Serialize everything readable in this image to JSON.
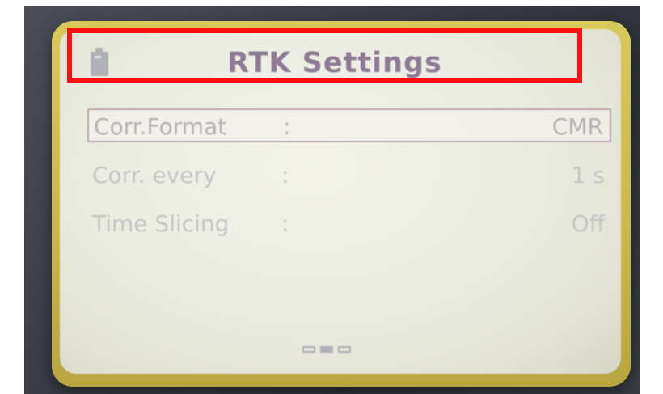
{
  "screen": {
    "title": "RTK Settings",
    "title_icon": "sd-card-icon"
  },
  "settings": [
    {
      "label": "Corr.Format",
      "separator": ":",
      "value": "CMR",
      "selected": true
    },
    {
      "label": "Corr. every",
      "separator": ":",
      "value": "1 s",
      "selected": false
    },
    {
      "label": "Time Slicing",
      "separator": ":",
      "value": "Off",
      "selected": false
    }
  ],
  "pagination": {
    "pages": 3,
    "current_page": 2
  },
  "colors": {
    "highlight": "#ff1010",
    "title": "#8f7a96",
    "bezel": "#d8c95a"
  }
}
